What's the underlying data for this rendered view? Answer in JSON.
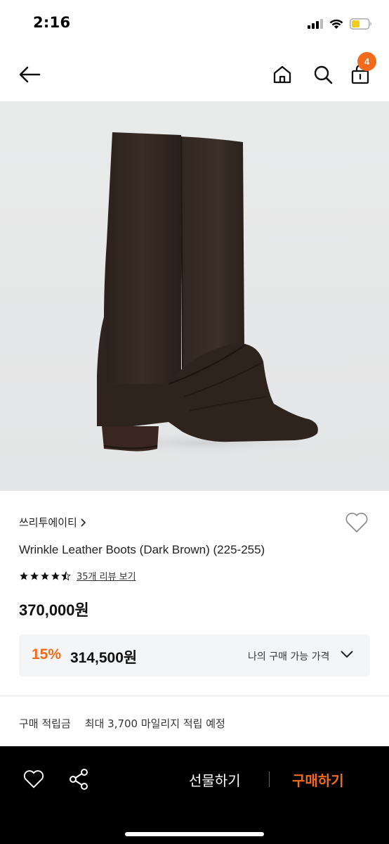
{
  "status_bar": {
    "time": "2:16"
  },
  "header": {
    "cart_count": "4"
  },
  "product": {
    "brand": "쓰리투에이티",
    "name": "Wrinkle Leather Boots (Dark Brown) (225-255)",
    "rating": 4.5,
    "review_link": "35개 리뷰 보기",
    "price": "370,000원",
    "discount": {
      "rate": "15%",
      "price": "314,500원",
      "label": "나의 구매 가능 가격"
    },
    "points": {
      "label": "구매 적립금",
      "value": "최대 3,700 마일리지 적립 예정"
    }
  },
  "bottom_bar": {
    "gift_label": "선물하기",
    "buy_label": "구매하기"
  },
  "colors": {
    "accent": "#f26a1b",
    "bottom_bar": "#000000"
  },
  "icons": [
    "back-arrow-icon",
    "home-icon",
    "search-icon",
    "shopping-bag-icon",
    "heart-icon",
    "share-icon",
    "chevron-right-icon",
    "chevron-down-icon",
    "star-icon"
  ]
}
